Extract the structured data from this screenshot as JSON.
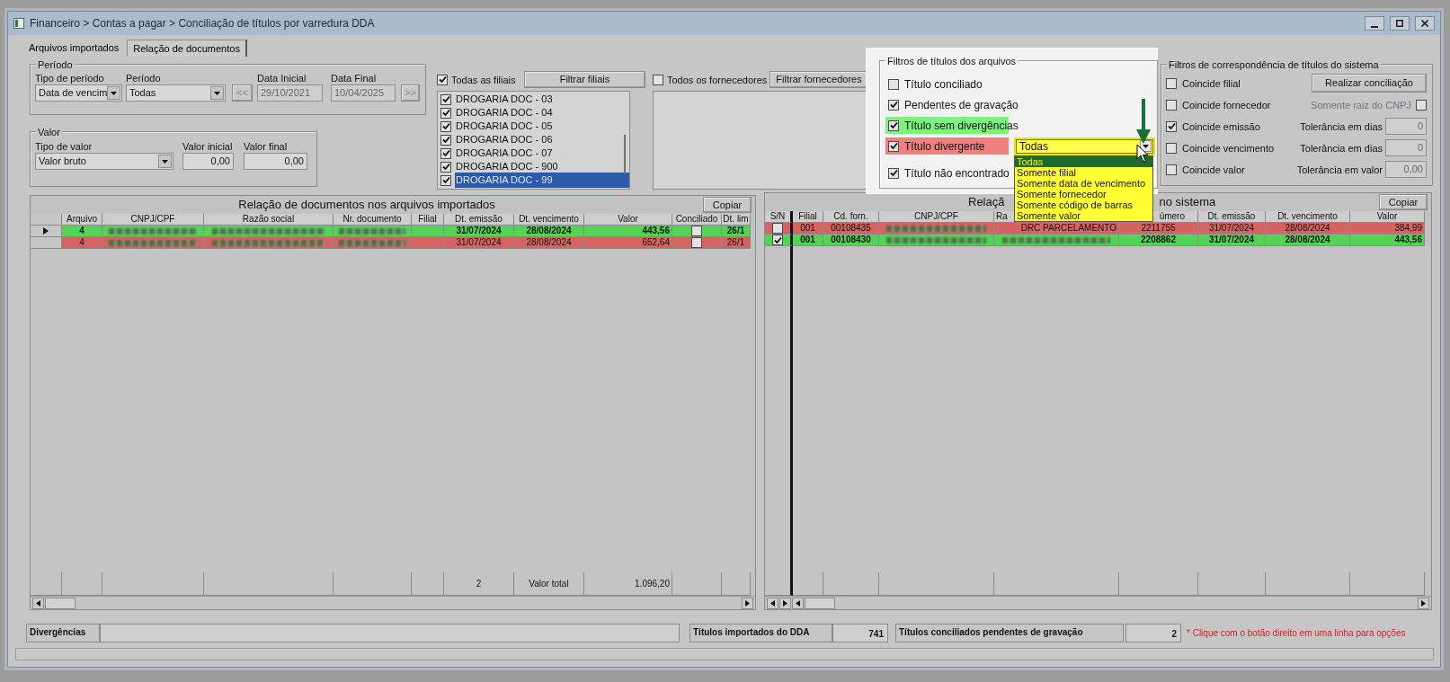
{
  "window": {
    "title": "Financeiro > Contas a pagar > Conciliação de títulos por varredura DDA"
  },
  "tabs": [
    {
      "label": "Arquivos importados",
      "selected": false
    },
    {
      "label": "Relação de documentos",
      "selected": true
    }
  ],
  "periodo": {
    "title": "Período",
    "tipo_label": "Tipo de período",
    "tipo_value": "Data de vencim",
    "periodo_label": "Período",
    "periodo_value": "Todas",
    "prev_button": "<<",
    "data_inicial_label": "Data Inicial",
    "data_inicial": "29/10/2021",
    "data_final_label": "Data Final",
    "data_final": "10/04/2025",
    "next_button": ">>",
    "dates_disabled": true
  },
  "valor": {
    "title": "Valor",
    "tipo_label": "Tipo de valor",
    "tipo_value": "Valor bruto",
    "inicial_label": "Valor inicial",
    "inicial": "0,00",
    "final_label": "Valor final",
    "final": "0,00"
  },
  "filiais": {
    "all_label": "Todas as filiais",
    "all_checked": true,
    "button": "Filtrar filiais",
    "items": [
      {
        "label": "DROGARIA DOC - 03",
        "checked": true,
        "selected": false
      },
      {
        "label": "DROGARIA DOC - 04",
        "checked": true,
        "selected": false
      },
      {
        "label": "DROGARIA DOC - 05",
        "checked": true,
        "selected": false
      },
      {
        "label": "DROGARIA DOC - 06",
        "checked": true,
        "selected": false
      },
      {
        "label": "DROGARIA DOC - 07",
        "checked": true,
        "selected": false
      },
      {
        "label": "DROGARIA DOC - 900",
        "checked": true,
        "selected": false
      },
      {
        "label": "DROGARIA DOC - 99",
        "checked": true,
        "selected": true
      }
    ]
  },
  "fornecedores": {
    "all_label": "Todos os fornecedores",
    "all_checked": false,
    "button": "Filtrar fornecedores"
  },
  "filtros_arquivos": {
    "title": "Filtros de títulos dos arquivos",
    "items": [
      {
        "label": "Título conciliado",
        "checked": false
      },
      {
        "label": "Pendentes de gravação",
        "checked": true
      },
      {
        "label": "Título sem divergências",
        "checked": true,
        "color": "#80f080"
      },
      {
        "label": "Título divergente",
        "checked": true,
        "color": "#f08080",
        "dropdown": {
          "value": "Todas",
          "options": [
            {
              "label": "Todas",
              "selected": true
            },
            {
              "label": "Somente filial",
              "selected": false
            },
            {
              "label": "Somente data de vencimento",
              "selected": false
            },
            {
              "label": "Somente fornecedor",
              "selected": false
            },
            {
              "label": "Somente código de barras",
              "selected": false
            },
            {
              "label": "Somente valor",
              "selected": false
            }
          ]
        }
      },
      {
        "label": "Título não encontrado",
        "checked": true
      }
    ]
  },
  "filtros_sistema": {
    "title": "Filtros de correspondência de títulos do sistema",
    "items": [
      {
        "label": "Coincide filial",
        "checked": false,
        "extra": {
          "kind": "button",
          "label": "Realizar conciliação"
        }
      },
      {
        "label": "Coincide fornecedor",
        "checked": false,
        "extra": {
          "kind": "checkbox",
          "label": "Somente raiz do CNPJ",
          "checked": false,
          "disabled": true
        }
      },
      {
        "label": "Coincide emissão",
        "checked": true,
        "extra": {
          "kind": "field",
          "label": "Tolerância em dias",
          "value": "0"
        }
      },
      {
        "label": "Coincide vencimento",
        "checked": false,
        "extra": {
          "kind": "field",
          "label": "Tolerância em dias",
          "value": "0"
        }
      },
      {
        "label": "Coincide valor",
        "checked": false,
        "extra": {
          "kind": "field",
          "label": "Tolerância em valor",
          "value": "0,00"
        }
      }
    ]
  },
  "left_grid": {
    "title": "Relação de documentos nos arquivos importados",
    "copy_button": "Copiar",
    "columns": [
      {
        "kind": "indicator"
      },
      {
        "kind": "text",
        "title": "Arquivo"
      },
      {
        "kind": "text",
        "title": "CNPJ/CPF"
      },
      {
        "kind": "text",
        "title": "Razão social"
      },
      {
        "kind": "text",
        "title": "Nr. documento"
      },
      {
        "kind": "text",
        "title": "Filial"
      },
      {
        "kind": "text",
        "title": "Dt. emissão",
        "footer": "2"
      },
      {
        "kind": "text",
        "title": "Dt. vencimento",
        "footer": "Valor total"
      },
      {
        "kind": "text",
        "title": "Valor",
        "footer": "1.096,20"
      },
      {
        "kind": "check",
        "title": "Conciliado"
      },
      {
        "kind": "text",
        "title": "Dt. lim"
      }
    ],
    "rows": [
      {
        "color": "#54d454",
        "cells": [
          {
            "kind": "indicator",
            "current": true
          },
          "4",
          {
            "kind": "redacted"
          },
          {
            "kind": "redacted"
          },
          {
            "kind": "redacted"
          },
          "",
          "31/07/2024",
          "28/08/2024",
          "443,56",
          {
            "kind": "check",
            "checked": false
          },
          "26/1"
        ]
      },
      {
        "color": "#d66262",
        "cells": [
          {
            "kind": "indicator",
            "current": false
          },
          "4",
          {
            "kind": "redacted"
          },
          {
            "kind": "redacted"
          },
          {
            "kind": "redacted"
          },
          "",
          "31/07/2024",
          "28/08/2024",
          "652,64",
          {
            "kind": "check",
            "checked": false
          },
          "26/1"
        ]
      }
    ]
  },
  "right_grid": {
    "title_start": "Relaçã",
    "title_end": "no sistema",
    "copy_button": "Copiar",
    "columns": [
      {
        "title": "S/N"
      },
      {
        "title": "Filial"
      },
      {
        "title": "Cd. forn."
      },
      {
        "title": "CNPJ/CPF"
      },
      {
        "title": "Ra"
      },
      {
        "title": "úmero"
      },
      {
        "title": "Dt. emissão"
      },
      {
        "title": "Dt. vencimento"
      },
      {
        "title": "Valor"
      }
    ],
    "rows": [
      {
        "color": "#d66262",
        "cells": [
          {
            "kind": "check",
            "checked": false
          },
          "001",
          "00108435",
          {
            "kind": "redacted"
          },
          "DRC PARCELAMENTO",
          "2211755",
          "31/07/2024",
          "28/08/2024",
          "384,99"
        ]
      },
      {
        "color": "#54d454",
        "cells": [
          {
            "kind": "check",
            "checked": true
          },
          "001",
          "00108430",
          {
            "kind": "redacted"
          },
          {
            "kind": "redacted"
          },
          "2208862",
          "31/07/2024",
          "28/08/2024",
          "443,56"
        ]
      }
    ]
  },
  "bottom": {
    "divergencias_label": "Divergências",
    "importados_label": "Títulos importados do DDA",
    "importados_value": "741",
    "pendentes_label": "Títulos conciliados pendentes de gravação",
    "pendentes_value": "2",
    "hint": "* Clique com o botão direito em uma linha para opções"
  }
}
